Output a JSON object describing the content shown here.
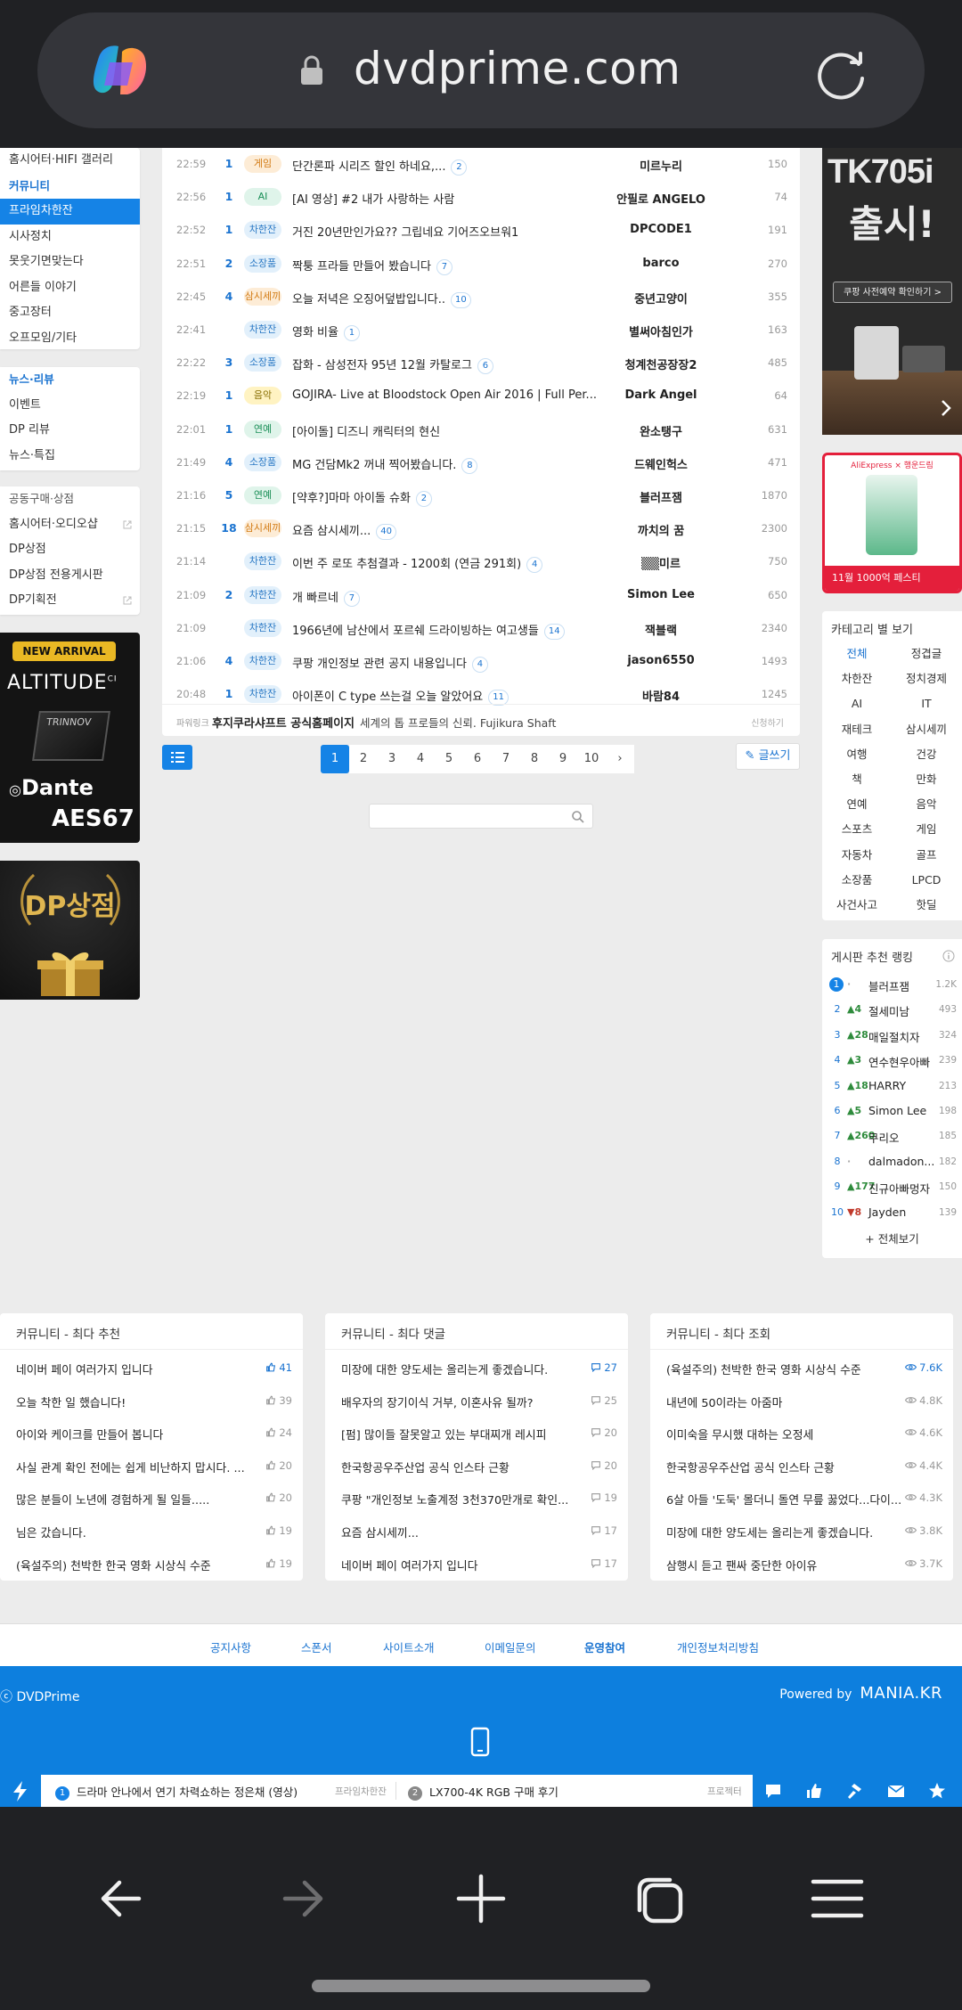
{
  "browser": {
    "url": "dvdprime.com"
  },
  "sidebar_top": [
    {
      "label": "홈시어터·HIFI 갤러리",
      "style": "normal"
    },
    {
      "label": "커뮤니티",
      "style": "header"
    },
    {
      "label": "프라임차한잔",
      "style": "active"
    },
    {
      "label": "시사정치",
      "style": "normal"
    },
    {
      "label": "못웃기면맞는다",
      "style": "normal"
    },
    {
      "label": "어른들 이야기",
      "style": "normal"
    },
    {
      "label": "중고장터",
      "style": "normal"
    },
    {
      "label": "오프모임/기타",
      "style": "normal"
    }
  ],
  "sidebar_news": [
    {
      "label": "뉴스·리뷰",
      "style": "header"
    },
    {
      "label": "이벤트",
      "style": "normal"
    },
    {
      "label": "DP 리뷰",
      "style": "normal"
    },
    {
      "label": "뉴스·특집",
      "style": "normal"
    }
  ],
  "sidebar_shop": [
    {
      "label": "공동구매·상점",
      "style": "header-gray"
    },
    {
      "label": "홈시어터·오디오샵",
      "style": "ext"
    },
    {
      "label": "DP상점",
      "style": "normal"
    },
    {
      "label": "DP상점 전용게시판",
      "style": "normal"
    },
    {
      "label": "DP기획전",
      "style": "ext"
    }
  ],
  "banner_left1": {
    "badge": "NEW ARRIVAL",
    "brand1": "ALTITUDE",
    "brand1_sup": "CI",
    "brand2": "TRINNOV",
    "brand3": "Dante",
    "brand4": "AES67"
  },
  "banner_left2": {
    "title": "DP상점"
  },
  "posts": [
    {
      "time": "22:59",
      "count": "1",
      "tag": "게임",
      "tag_color": "orange",
      "title": "단간론파 시리즈 할인 하네요,...",
      "comments": "2",
      "author": "미르누리",
      "views": "150"
    },
    {
      "time": "22:56",
      "count": "1",
      "tag": "AI",
      "tag_color": "green",
      "title": "[AI 영상] #2 내가 사랑하는 사람",
      "comments": "",
      "author": "안필로 ANGELO",
      "views": "74"
    },
    {
      "time": "22:52",
      "count": "1",
      "tag": "차한잔",
      "tag_color": "blue",
      "title": "거진 20년만인가요?? 그립네요 기어즈오브워1",
      "comments": "",
      "author": "DPCODE1",
      "views": "191"
    },
    {
      "time": "22:51",
      "count": "2",
      "tag": "소장품",
      "tag_color": "blue",
      "title": "짝퉁 프라들 만들어 봤습니다",
      "comments": "7",
      "author": "barco",
      "views": "270"
    },
    {
      "time": "22:45",
      "count": "4",
      "tag": "삼시세끼",
      "tag_color": "orange",
      "title": "오늘 저녁은 오징어덮밥입니다..",
      "comments": "10",
      "author": "중년고양이",
      "views": "355"
    },
    {
      "time": "22:41",
      "count": "",
      "tag": "차한잔",
      "tag_color": "blue",
      "title": "영화 비율",
      "comments": "1",
      "author": "별써아침인가",
      "views": "163"
    },
    {
      "time": "22:22",
      "count": "3",
      "tag": "소장품",
      "tag_color": "blue",
      "title": "잡화 - 삼성전자 95년 12월 카탈로그",
      "comments": "6",
      "author": "청계천공장장2",
      "views": "485"
    },
    {
      "time": "22:19",
      "count": "1",
      "tag": "음악",
      "tag_color": "yellow",
      "title": "GOJIRA- Live at Bloodstock Open Air 2016 | Full Per...",
      "comments": "",
      "author": "Dark Angel",
      "views": "64"
    },
    {
      "time": "22:01",
      "count": "1",
      "tag": "연예",
      "tag_color": "green",
      "title": "[아이돌] 디즈니 캐릭터의 현신",
      "comments": "",
      "author": "완소탱구",
      "views": "631"
    },
    {
      "time": "21:49",
      "count": "4",
      "tag": "소장품",
      "tag_color": "blue",
      "title": "MG 건담Mk2 꺼내 찍어봤습니다.",
      "comments": "8",
      "author": "드웨인헉스",
      "views": "471"
    },
    {
      "time": "21:16",
      "count": "5",
      "tag": "연예",
      "tag_color": "green",
      "title": "[약후?]마마 아이돌 슈화",
      "comments": "2",
      "author": "블러프잼",
      "views": "1870"
    },
    {
      "time": "21:15",
      "count": "18",
      "tag": "삼시세끼",
      "tag_color": "orange",
      "title": "요즘 삼시세끼...",
      "comments": "40",
      "author": "까치의 꿈",
      "views": "2300"
    },
    {
      "time": "21:14",
      "count": "",
      "tag": "차한잔",
      "tag_color": "blue",
      "title": "이번 주 로또 추첨결과 - 1200회 (연금 291회)",
      "comments": "4",
      "author": "▒▒미르",
      "views": "750"
    },
    {
      "time": "21:09",
      "count": "2",
      "tag": "차한잔",
      "tag_color": "blue",
      "title": "개 빠르네",
      "comments": "7",
      "author": "Simon Lee",
      "views": "650"
    },
    {
      "time": "21:09",
      "count": "",
      "tag": "차한잔",
      "tag_color": "blue",
      "title": "1966년에 남산에서 포르쉐 드라이빙하는 여고생들",
      "comments": "14",
      "author": "잭블랙",
      "views": "2340"
    },
    {
      "time": "21:06",
      "count": "4",
      "tag": "차한잔",
      "tag_color": "blue",
      "title": "쿠팡 개인정보 관련 공지 내용입니다",
      "comments": "4",
      "author": "jason6550",
      "views": "1493"
    },
    {
      "time": "20:48",
      "count": "1",
      "tag": "차한잔",
      "tag_color": "blue",
      "title": "아이폰이 C type 쓰는걸 오늘 알았어요",
      "comments": "11",
      "author": "바람84",
      "views": "1245"
    }
  ],
  "ad_row": {
    "label": "파워링크",
    "title": "후지쿠라샤프트 공식홈페이지",
    "desc": "세계의 톱 프로들의 신뢰. Fujikura Shaft",
    "apply": "신청하기"
  },
  "pagination": {
    "pages": [
      "1",
      "2",
      "3",
      "4",
      "5",
      "6",
      "7",
      "8",
      "9",
      "10"
    ],
    "current": 0,
    "next": "›"
  },
  "write_label": "글쓰기",
  "right_ad1": {
    "model": "TK705i",
    "headline": "출시!",
    "cta": "쿠팡 사전예약 확인하기 >"
  },
  "right_ad2": {
    "brand": "AliExpress × 행운드림",
    "cta": "11월 1000억 페스티"
  },
  "categories": {
    "title": "카테고리 별 보기",
    "items": [
      "전체",
      "정겹글",
      "차한잔",
      "정치경제",
      "AI",
      "IT",
      "재테크",
      "삼시세끼",
      "여행",
      "건강",
      "책",
      "만화",
      "연예",
      "음악",
      "스포츠",
      "게임",
      "자동차",
      "골프",
      "소장품",
      "LPCD",
      "사건사고",
      "핫딜"
    ],
    "selected": 0
  },
  "ranking": {
    "title": "게시판 추천 랭킹",
    "items": [
      {
        "rank": "1",
        "change": "·",
        "dir": "same",
        "name": "블러프잼",
        "score": "1.2K"
      },
      {
        "rank": "2",
        "change": "▲4",
        "dir": "up",
        "name": "절세미남",
        "score": "493"
      },
      {
        "rank": "3",
        "change": "▲28",
        "dir": "up",
        "name": "매일절치자",
        "score": "324"
      },
      {
        "rank": "4",
        "change": "▲3",
        "dir": "up",
        "name": "연수현우아빠",
        "score": "239"
      },
      {
        "rank": "5",
        "change": "▲18",
        "dir": "up",
        "name": "HARRY",
        "score": "213"
      },
      {
        "rank": "6",
        "change": "▲5",
        "dir": "up",
        "name": "Simon Lee",
        "score": "198"
      },
      {
        "rank": "7",
        "change": "▲260",
        "dir": "up",
        "name": "쿠리오",
        "score": "185"
      },
      {
        "rank": "8",
        "change": "·",
        "dir": "same",
        "name": "dalmadon...",
        "score": "182"
      },
      {
        "rank": "9",
        "change": "▲177",
        "dir": "up",
        "name": "진규아빠멍자",
        "score": "150"
      },
      {
        "rank": "10",
        "change": "▼8",
        "dir": "down",
        "name": "Jayden",
        "score": "139"
      }
    ],
    "more": "+ 전체보기"
  },
  "community_boxes": [
    {
      "title": "커뮤니티 - 최다 추천",
      "icon": "thumbs-up",
      "items": [
        {
          "text": "네이버 페이 여러가지 입니다",
          "meta": "41"
        },
        {
          "text": "오늘 착한 일 했습니다!",
          "meta": "39"
        },
        {
          "text": "아이와 케이크를 만들어 봅니다",
          "meta": "24"
        },
        {
          "text": "사실 관계 확인 전에는 쉽게 비난하지 맙시다. ...",
          "meta": "20"
        },
        {
          "text": "많은 분들이 노년에 경험하게 될 일들.....",
          "meta": "20"
        },
        {
          "text": "님은 갔습니다.",
          "meta": "19"
        },
        {
          "text": "(육설주의) 천박한 한국 영화 시상식 수준",
          "meta": "19"
        }
      ]
    },
    {
      "title": "커뮤니티 - 최다 댓글",
      "icon": "comment",
      "items": [
        {
          "text": "미장에 대한 양도세는 올리는게 좋겠습니다.",
          "meta": "27"
        },
        {
          "text": "배우자의 장기이식 거부, 이혼사유 될까?",
          "meta": "25"
        },
        {
          "text": "[펌] 많이들 잘못알고 있는 부대찌개 레시피",
          "meta": "20"
        },
        {
          "text": "한국항공우주산업 공식 인스타 근황",
          "meta": "20"
        },
        {
          "text": "쿠팡 \"개인정보 노출계정 3천370만개로 확인...",
          "meta": "19"
        },
        {
          "text": "요즘 삼시세끼...",
          "meta": "17"
        },
        {
          "text": "네이버 페이 여러가지 입니다",
          "meta": "17"
        }
      ]
    },
    {
      "title": "커뮤니티 - 최다 조회",
      "icon": "eye",
      "items": [
        {
          "text": "(육설주의) 천박한 한국 영화 시상식 수준",
          "meta": "7.6K"
        },
        {
          "text": "내년에 50이라는 아줌마",
          "meta": "4.8K"
        },
        {
          "text": "이미숙을 무시했 대하는 오정세",
          "meta": "4.6K"
        },
        {
          "text": "한국항공우주산업 공식 인스타 근황",
          "meta": "4.4K"
        },
        {
          "text": "6살 아들 '도둑' 몰더니 돌연 무릎 꿇었다...다이...",
          "meta": "4.3K"
        },
        {
          "text": "미장에 대한 양도세는 올리는게 좋겠습니다.",
          "meta": "3.8K"
        },
        {
          "text": "삼행시 듣고 팬싸 중단한 아이유",
          "meta": "3.7K"
        }
      ]
    }
  ],
  "footer_links": [
    "공지사항",
    "스폰서",
    "사이트소개",
    "이메일문의",
    "운영참여",
    "개인정보처리방침"
  ],
  "footer": {
    "copyright": "ⓒ DVDPrime",
    "powered_label": "Powered by",
    "powered_brand": "MANIA.KR"
  },
  "ticker": [
    {
      "num": "1",
      "title": "드라마 안나에서 연기 차력쇼하는 정은채 (영상)",
      "board": "프라임차한잔"
    },
    {
      "num": "2",
      "title": "LX700-4K RGB 구매 후기",
      "board": "프로젝터"
    }
  ],
  "colors": {
    "accent": "#1583e6",
    "footer_blue": "#0d7fde",
    "browser_bg": "#202124"
  }
}
